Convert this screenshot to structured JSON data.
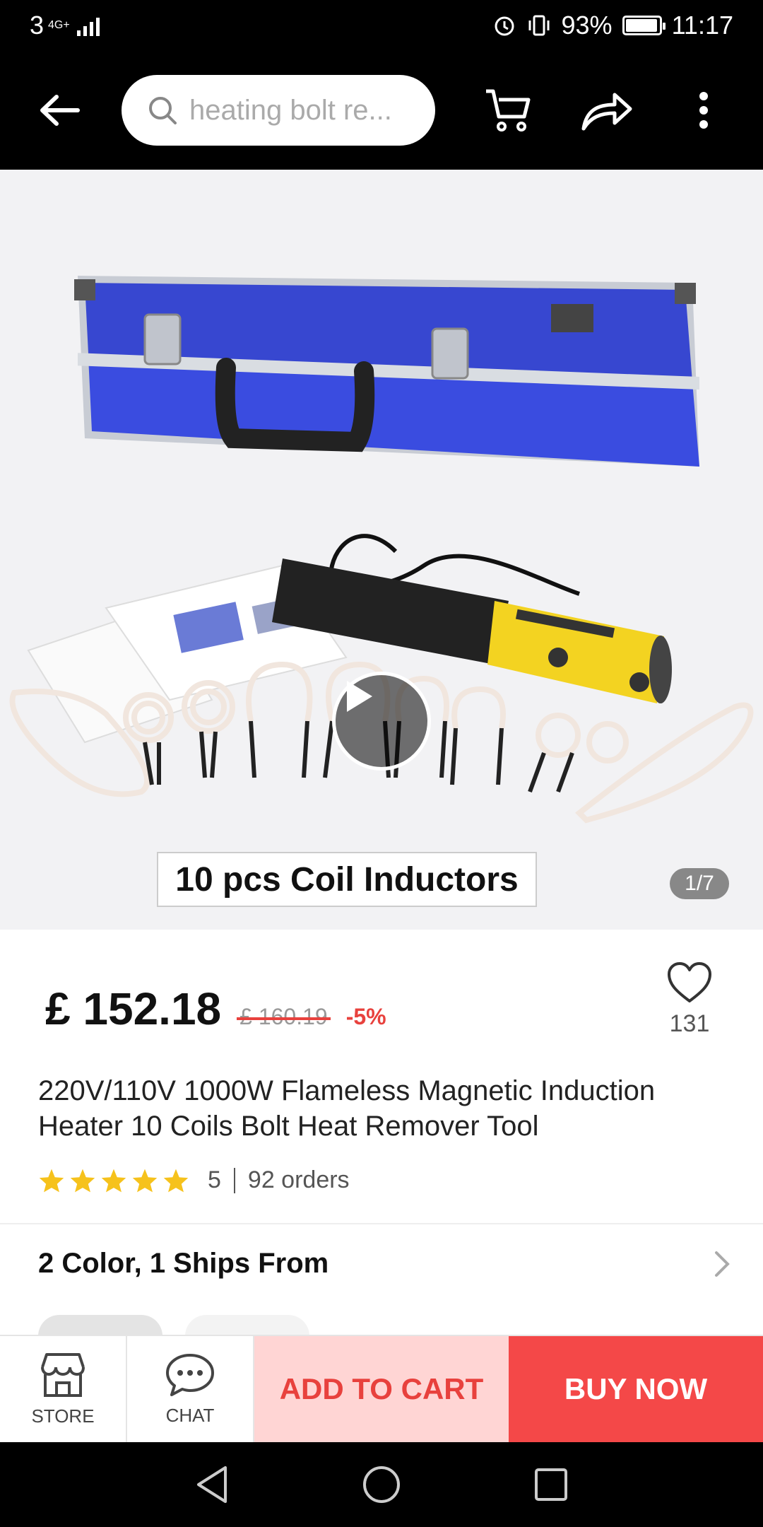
{
  "status_bar": {
    "carrier": "3",
    "network": "4G+",
    "battery": "93%",
    "time": "11:17"
  },
  "search": {
    "placeholder": "heating bolt re..."
  },
  "gallery": {
    "caption": "10 pcs Coil Inductors",
    "counter": "1/7",
    "case_color": "#2f3fd0",
    "device_color": "#f3d321"
  },
  "product": {
    "price": "£ 152.18",
    "original_price": "£ 160.19",
    "discount": "-5%",
    "wishlist_count": "131",
    "title": "220V/110V 1000W Flameless Magnetic Induction Heater 10 Coils Bolt Heat Remover Tool",
    "rating": "5",
    "orders": "92 orders",
    "sku_summary": "2 Color, 1 Ships From"
  },
  "actions": {
    "store": "STORE",
    "chat": "CHAT",
    "add_to_cart": "ADD TO CART",
    "buy_now": "BUY NOW"
  },
  "colors": {
    "accent": "#e8413d",
    "add_cart_bg": "#ffd5d4",
    "buy_bg": "#f44848",
    "star": "#f6c21c"
  }
}
